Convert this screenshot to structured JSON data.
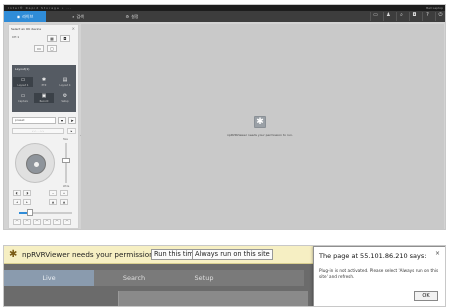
{
  "top": {
    "system_bar": {
      "left_text": "Intel® Rapid Storage • ...",
      "right_text": "Bell Laptop"
    },
    "tabs": [
      {
        "label": "라이브",
        "icon": "live-icon",
        "active": true
      },
      {
        "label": "검색",
        "icon": "search-icon",
        "active": false
      },
      {
        "label": "설정",
        "icon": "gear-icon",
        "active": false
      }
    ],
    "tools": [
      "layout-icon",
      "user-icon",
      "search-icon",
      "camera-icon",
      "help-icon",
      "exit-icon"
    ],
    "sidebar": {
      "header": "Select an OK device",
      "close": "×",
      "row1_label": "CH 1",
      "dark_block_title": "Layout(1)",
      "dark_cells": [
        {
          "glyph": "▭",
          "label": "Layout 1"
        },
        {
          "glyph": "✱",
          "label": "PTZ"
        },
        {
          "glyph": "▤",
          "label": "Layout 4"
        },
        {
          "glyph": "▭",
          "label": "Capture"
        },
        {
          "glyph": "▣",
          "label": "Record"
        },
        {
          "glyph": "⚙",
          "label": "Setup"
        }
      ],
      "preset_label": "preset",
      "dir_strip": "‹ ‹ · · › ›",
      "zoom_label_top": "Tele",
      "zoom_label_bottom": "Wide",
      "focus_accent": "#2f8cd8"
    },
    "plugin": {
      "icon": "plugin-puzzle-icon",
      "message": "npRVRViewer needs your permission to run."
    }
  },
  "bottom": {
    "infobar": {
      "message": "npRVRViewer needs your permission to run.",
      "run_button": "Run this time",
      "always_button": "Always run on this site"
    },
    "nav": {
      "live": "Live",
      "search": "Search",
      "setup": "Setup"
    },
    "dialog": {
      "title": "The page at 55.101.86.210 says:",
      "close": "×",
      "message": "Plug-in is not activated. Please select 'Always run on this site' and refresh.",
      "ok": "OK"
    }
  }
}
